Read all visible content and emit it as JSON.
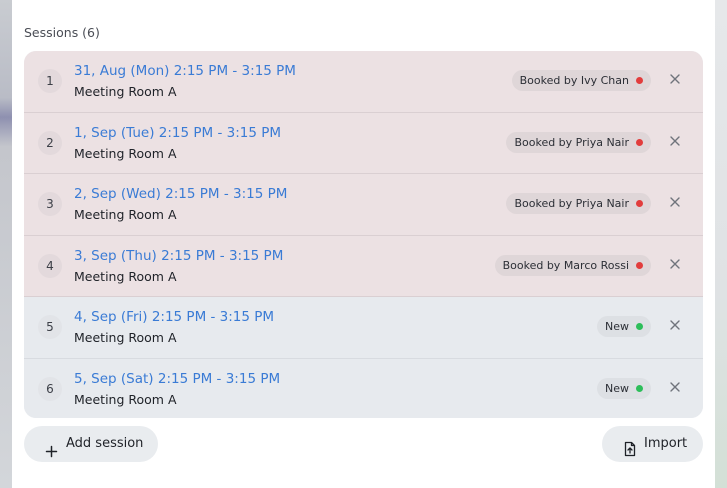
{
  "sessions_header": "Sessions (6)",
  "sessions": [
    {
      "number": "1",
      "title": "31, Aug (Mon) 2:15 PM - 3:15 PM",
      "room": "Meeting Room A",
      "status": "Booked by Ivy Chan",
      "status_type": "booked"
    },
    {
      "number": "2",
      "title": "1, Sep (Tue) 2:15 PM - 3:15 PM",
      "room": "Meeting Room A",
      "status": "Booked by Priya Nair",
      "status_type": "booked"
    },
    {
      "number": "3",
      "title": "2, Sep (Wed) 2:15 PM - 3:15 PM",
      "room": "Meeting Room A",
      "status": "Booked by Priya Nair",
      "status_type": "booked"
    },
    {
      "number": "4",
      "title": "3, Sep (Thu) 2:15 PM - 3:15 PM",
      "room": "Meeting Room A",
      "status": "Booked by Marco Rossi",
      "status_type": "booked"
    },
    {
      "number": "5",
      "title": "4, Sep (Fri) 2:15 PM - 3:15 PM",
      "room": "Meeting Room A",
      "status": "New",
      "status_type": "new"
    },
    {
      "number": "6",
      "title": "5, Sep (Sat) 2:15 PM - 3:15 PM",
      "room": "Meeting Room A",
      "status": "New",
      "status_type": "new"
    }
  ],
  "actions": {
    "add_session_label": "Add session",
    "import_label": "Import"
  },
  "icons": {
    "add": "plus-icon",
    "import": "file-import-icon",
    "remove": "close-icon"
  },
  "colors": {
    "link": "#3a7bd5",
    "booked_row": "#ece1e3",
    "new_row": "#e7eaee",
    "booked_dot": "#e23d3d",
    "new_dot": "#2dbe5a"
  }
}
